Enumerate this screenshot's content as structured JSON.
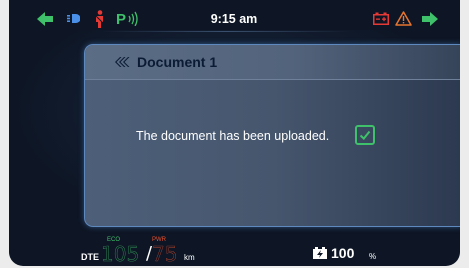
{
  "status_bar": {
    "time": "9:15 am",
    "icons": [
      "turn-left-arrow-icon",
      "headlight-icon",
      "seatbelt-icon",
      "parking-assist-icon",
      "battery-warning-icon",
      "warning-triangle-icon",
      "turn-right-arrow-icon"
    ]
  },
  "dialog": {
    "title": "Document 1",
    "message": "The document has been uploaded.",
    "checkbox_checked": true,
    "back_icon": "double-chevron-left-icon"
  },
  "dashboard": {
    "dte_label": "DTE",
    "eco_label": "ECO",
    "eco_value": "105",
    "separator": "/",
    "pwr_label": "PWR",
    "pwr_value": "75",
    "distance_unit": "km",
    "battery_value": "100",
    "battery_unit": "%"
  },
  "colors": {
    "screen_bg": "#0e1625",
    "accent_green": "#3fc06a",
    "accent_red": "#e8522f",
    "dialog_border": "#5e89bf",
    "title_text": "#0b1b33"
  }
}
